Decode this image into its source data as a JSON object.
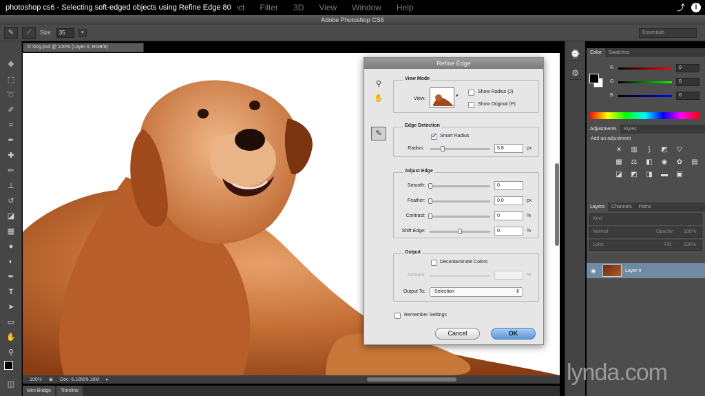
{
  "video": {
    "title": "photoshop cs6 - Selecting soft-edged objects using Refine Edge 80",
    "share_icon": "share-icon",
    "info_icon": "info-icon"
  },
  "menu": [
    "Select",
    "Filter",
    "3D",
    "View",
    "Window",
    "Help"
  ],
  "app": {
    "title": "Adobe Photoshop CS6"
  },
  "options": {
    "size_label": "Size:",
    "size_value": "35",
    "workspace": "Essentials"
  },
  "document": {
    "tab": "© Dog.psd @ 100% (Layer 0, RGB/8)",
    "zoom": "100%",
    "doc_size": "Doc: 6.18M/6.18M"
  },
  "bottom_tabs": [
    "Mini Bridge",
    "Timeline"
  ],
  "watermark": "lynda.com",
  "dialog": {
    "title": "Refine Edge",
    "view_mode": {
      "title": "View Mode",
      "view_label": "View:",
      "show_radius": "Show Radius (J)",
      "show_original": "Show Original (P)"
    },
    "edge_detection": {
      "title": "Edge Detection",
      "smart_radius": "Smart Radius",
      "smart_radius_checked": true,
      "radius_label": "Radius:",
      "radius_value": "5.8",
      "radius_unit": "px",
      "radius_level": 0.18
    },
    "adjust_edge": {
      "title": "Adjust Edge",
      "smooth_label": "Smooth:",
      "smooth_value": "0",
      "feather_label": "Feather:",
      "feather_value": "0.0",
      "feather_unit": "px",
      "contrast_label": "Contrast:",
      "contrast_value": "0",
      "contrast_unit": "%",
      "shift_label": "Shift Edge:",
      "shift_value": "0",
      "shift_unit": "%"
    },
    "output": {
      "title": "Output",
      "decontaminate": "Decontaminate Colors",
      "amount_label": "Amount:",
      "amount_unit": "%",
      "output_to_label": "Output To:",
      "output_to_value": "Selection"
    },
    "remember": "Remember Settings",
    "cancel": "Cancel",
    "ok": "OK"
  },
  "color_panel": {
    "tabs": [
      "Color",
      "Swatches"
    ],
    "r_label": "R",
    "g_label": "G",
    "b_label": "B",
    "r": "0",
    "g": "0",
    "b": "0"
  },
  "adjustments": {
    "tabs": [
      "Adjustments",
      "Styles"
    ],
    "title": "Add an adjustment"
  },
  "layers": {
    "tabs": [
      "Layers",
      "Channels",
      "Paths"
    ],
    "kind": "Kind",
    "blend": "Normal",
    "opacity_label": "Opacity:",
    "opacity": "100%",
    "lock_label": "Lock:",
    "fill_label": "Fill:",
    "fill": "100%",
    "layer_name": "Layer 0"
  }
}
